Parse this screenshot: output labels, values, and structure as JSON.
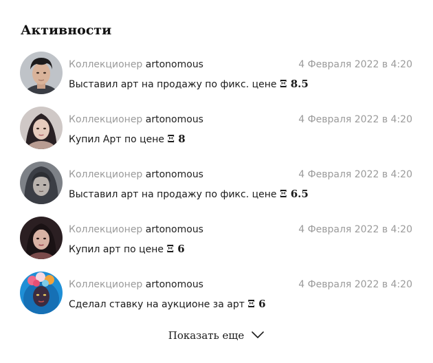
{
  "section_title": "Активности",
  "activities": [
    {
      "role": "Коллекционер",
      "user": "artonomous",
      "date": "4 Февраля 2022 в 4:20",
      "action": "Выставил арт на продажу по фикс. цене ",
      "price": "Ξ 8.5",
      "avatar": "avatar-young-man-icon"
    },
    {
      "role": "Коллекционер",
      "user": "artonomous",
      "date": "4 Февраля 2022 в 4:20",
      "action": "Купил Арт по цене ",
      "price": "Ξ 8",
      "avatar": "avatar-young-woman-icon"
    },
    {
      "role": "Коллекционер",
      "user": "artonomous",
      "date": "4 Февраля 2022 в 4:20",
      "action": "Выставил арт на продажу по фикс. цене ",
      "price": "Ξ 6.5",
      "avatar": "avatar-hooded-figure-icon"
    },
    {
      "role": "Коллекционер",
      "user": "artonomous",
      "date": "4 Февраля 2022 в 4:20",
      "action": "Купил арт по цене ",
      "price": "Ξ 6",
      "avatar": "avatar-dark-haired-woman-icon"
    },
    {
      "role": "Коллекционер",
      "user": "artonomous",
      "date": "4 Февраля 2022 в 4:20",
      "action": "Сделал ставку на аукционе за арт ",
      "price": "Ξ 6",
      "avatar": "avatar-floral-character-icon"
    }
  ],
  "show_more_label": "Показать еще",
  "show_more_icon": "chevron-down-icon"
}
